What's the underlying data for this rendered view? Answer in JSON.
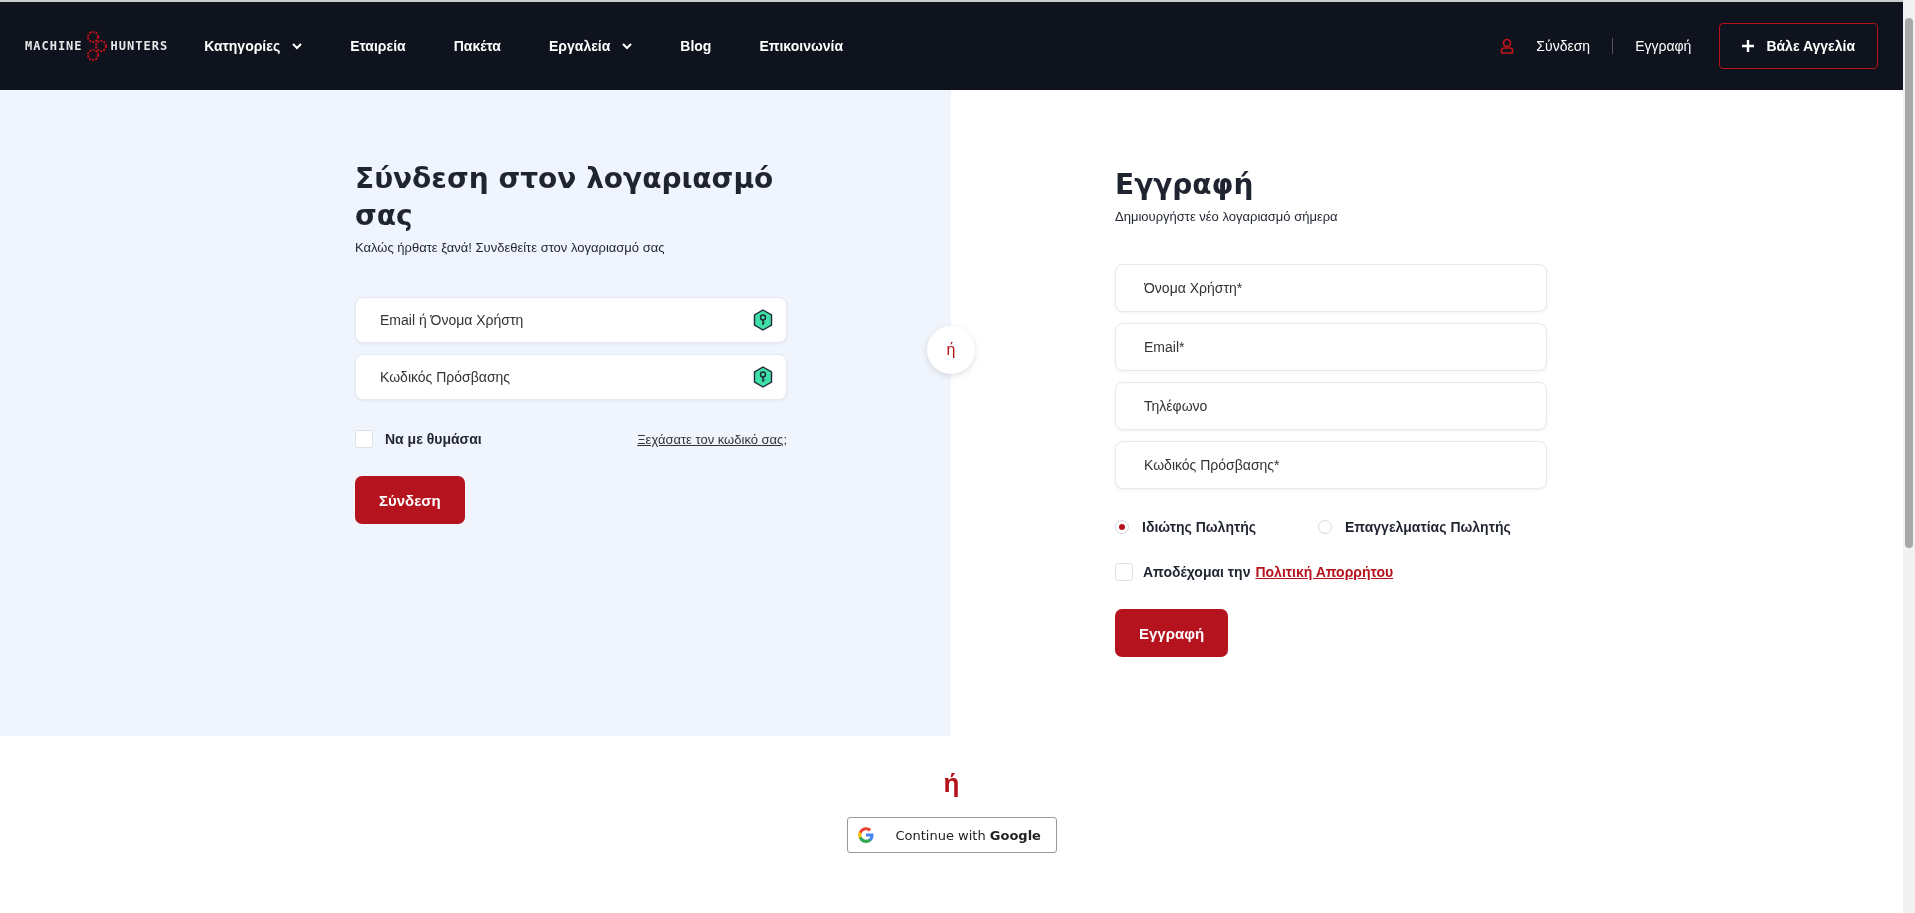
{
  "header": {
    "logo": {
      "left": "MACHINE",
      "right": "HUNTERS"
    },
    "nav": [
      {
        "label": "Κατηγορίες",
        "dropdown": true
      },
      {
        "label": "Εταιρεία",
        "dropdown": false
      },
      {
        "label": "Πακέτα",
        "dropdown": false
      },
      {
        "label": "Εργαλεία",
        "dropdown": true
      },
      {
        "label": "Blog",
        "dropdown": false
      },
      {
        "label": "Επικοινωνία",
        "dropdown": false
      }
    ],
    "login_link": "Σύνδεση",
    "register_link": "Εγγραφή",
    "post_button": "Βάλε Αγγελία"
  },
  "login": {
    "title": "Σύνδεση στον λογαριασμό σας",
    "subtitle": "Καλώς ήρθατε ξανά! Συνδεθείτε στον λογαριασμό σας",
    "fields": [
      {
        "placeholder": "Email ή Όνομα Χρήστη"
      },
      {
        "placeholder": "Κωδικός Πρόσβασης"
      }
    ],
    "remember": {
      "label": "Να με θυμάσαι",
      "checked": false
    },
    "forgot_link": "Ξεχάσατε τον κωδικό σας;",
    "button": "Σύνδεση"
  },
  "divider": "ή",
  "register": {
    "title": "Εγγραφή",
    "subtitle": "Δημιουργήστε νέο λογαριασμό σήμερα",
    "fields": [
      {
        "placeholder": "Όνομα Χρήστη*"
      },
      {
        "placeholder": "Email*"
      },
      {
        "placeholder": "Τηλέφωνο"
      },
      {
        "placeholder": "Κωδικός Πρόσβασης*"
      }
    ],
    "seller_types": [
      {
        "label": "Ιδιώτης Πωλητής",
        "selected": true
      },
      {
        "label": "Επαγγελματίας Πωλητής",
        "selected": false
      }
    ],
    "terms": {
      "label": "Αποδέχομαι την",
      "link": "Πολιτική Απορρήτου",
      "checked": false
    },
    "button": "Εγγραφή"
  },
  "or_text": "ή",
  "google_button": "Continue with **Google**"
}
